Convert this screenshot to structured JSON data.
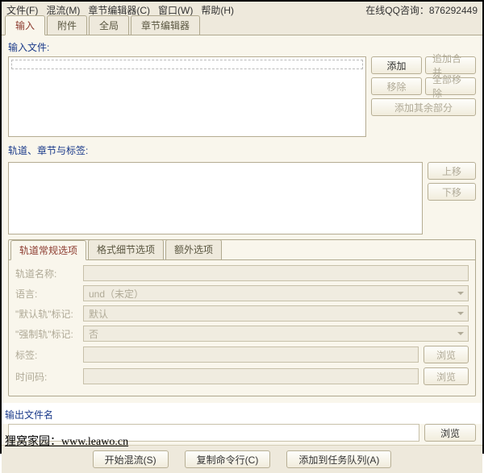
{
  "menubar": {
    "file": "文件(F)",
    "mux": "混流(M)",
    "chapter_editor": "章节编辑器(C)",
    "window": "窗口(W)",
    "help": "帮助(H)"
  },
  "qq_label": "在线QQ咨询：",
  "qq_number": "876292449",
  "top_tabs": {
    "input": "输入",
    "attachment": "附件",
    "global": "全局",
    "chapter_editor": "章节编辑器"
  },
  "input_section": {
    "label": "输入文件:",
    "add": "添加",
    "append": "追加合并",
    "remove": "移除",
    "remove_all": "全部移除",
    "add_rest": "添加其余部分"
  },
  "tracks_section": {
    "label": "轨道、章节与标签:",
    "move_up": "上移",
    "move_down": "下移"
  },
  "inner_tabs": {
    "general": "轨道常规选项",
    "format": "格式细节选项",
    "extra": "额外选项"
  },
  "form": {
    "track_name_label": "轨道名称:",
    "language_label": "语言:",
    "language_value": "und（未定）",
    "default_flag_label": "\"默认轨\"标记:",
    "default_flag_value": "默认",
    "forced_flag_label": "\"强制轨\"标记:",
    "forced_flag_value": "否",
    "tag_label": "标签:",
    "timecode_label": "时间码:",
    "browse": "浏览"
  },
  "output": {
    "label": "输出文件名",
    "browse": "浏览"
  },
  "bottom": {
    "start": "开始混流(S)",
    "copy_cli": "复制命令行(C)",
    "add_queue": "添加到任务队列(A)"
  },
  "footer": "狸窝家园：www.leawo.cn"
}
